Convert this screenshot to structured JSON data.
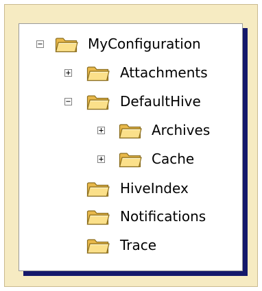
{
  "tree": {
    "root": {
      "label": "MyConfiguration",
      "toggle": "−",
      "icon": "folder-icon"
    },
    "attachments": {
      "label": "Attachments",
      "toggle": "+",
      "icon": "folder-icon"
    },
    "defaulthive": {
      "label": "DefaultHive",
      "toggle": "−",
      "icon": "folder-icon"
    },
    "archives": {
      "label": "Archives",
      "toggle": "+",
      "icon": "folder-icon"
    },
    "cache": {
      "label": "Cache",
      "toggle": "+",
      "icon": "folder-icon"
    },
    "hiveindex": {
      "label": "HiveIndex",
      "icon": "folder-icon"
    },
    "notifications": {
      "label": "Notifications",
      "icon": "folder-icon"
    },
    "trace": {
      "label": "Trace",
      "icon": "folder-icon"
    }
  },
  "colors": {
    "frame_background": "#f6ebc2",
    "shadow": "#15196a",
    "folder_fill": "#f7d469",
    "folder_outline": "#8a6d1e"
  }
}
